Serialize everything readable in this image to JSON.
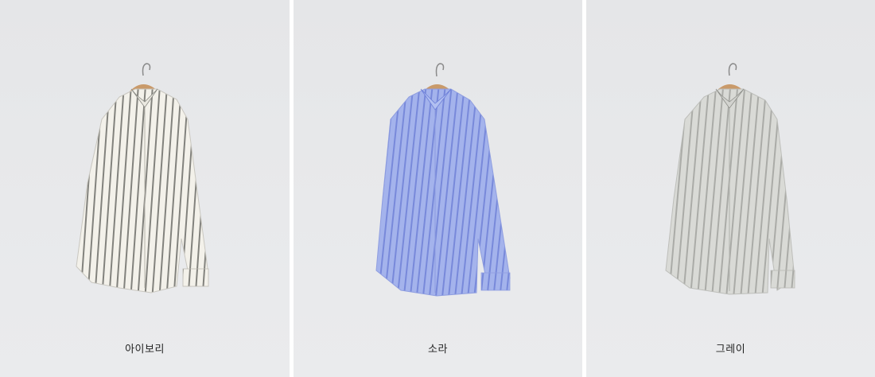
{
  "products": [
    {
      "color_name": "아이보리",
      "shirt_color": "#f3f1ea",
      "stripe_color": "#6e6e6a"
    },
    {
      "color_name": "소라",
      "shirt_color": "#9fb0ea",
      "stripe_color": "#5a6ccf"
    },
    {
      "color_name": "그레이",
      "shirt_color": "#d9dad6",
      "stripe_color": "#9a9b96"
    }
  ]
}
